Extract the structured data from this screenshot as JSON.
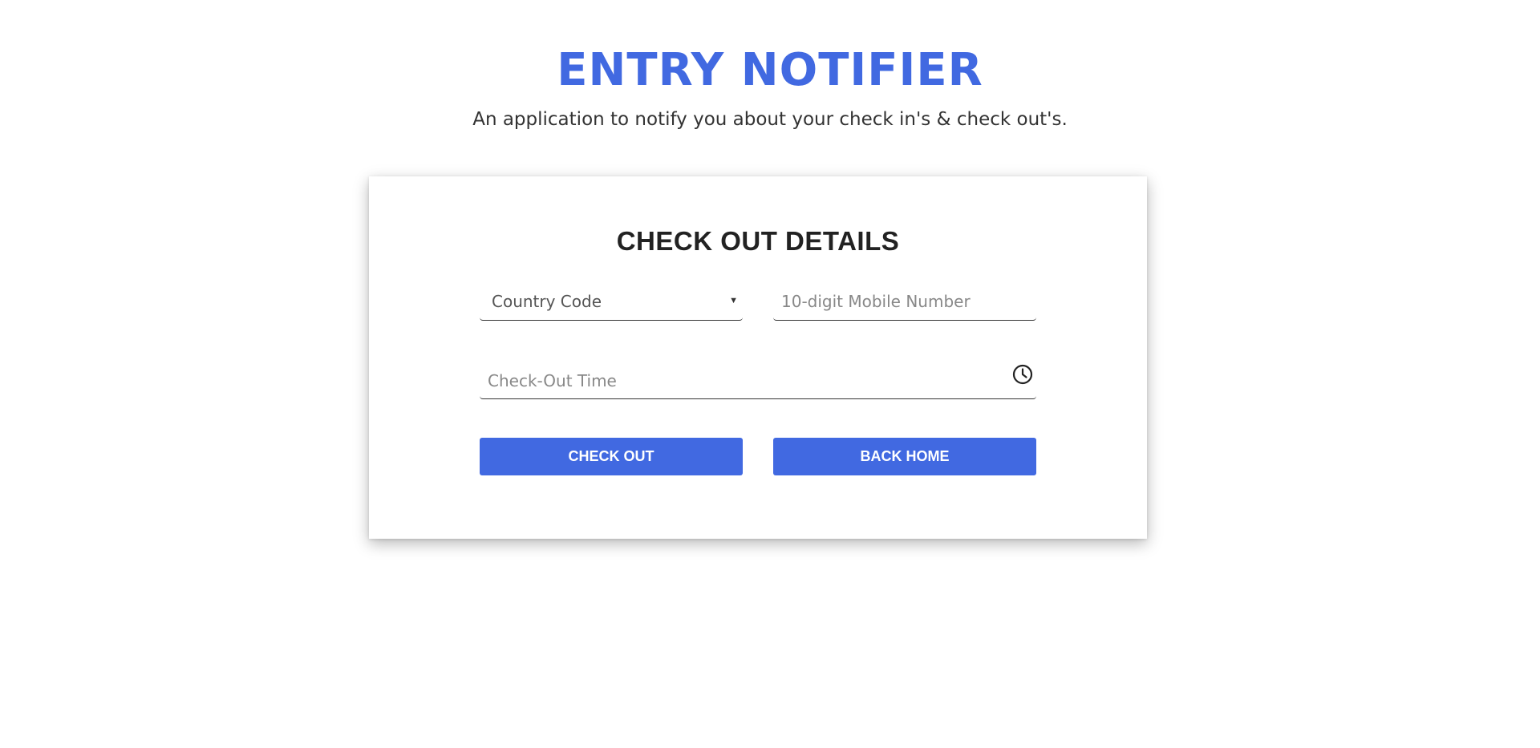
{
  "header": {
    "title": "ENTRY NOTIFIER",
    "subtitle": "An application to notify you about your check in's & check out's."
  },
  "form": {
    "title": "CHECK OUT DETAILS",
    "country_code": {
      "selected": "Country Code"
    },
    "mobile": {
      "placeholder": "10-digit Mobile Number",
      "value": ""
    },
    "checkout_time": {
      "placeholder": "Check-Out Time",
      "value": ""
    },
    "buttons": {
      "check_out": "CHECK OUT",
      "back_home": "BACK HOME"
    }
  },
  "icons": {
    "country_dropdown": "caret-down-icon",
    "time_picker": "clock-icon"
  },
  "colors": {
    "accent": "#4169e1",
    "text_dark": "#222222",
    "text_muted": "#888888"
  }
}
